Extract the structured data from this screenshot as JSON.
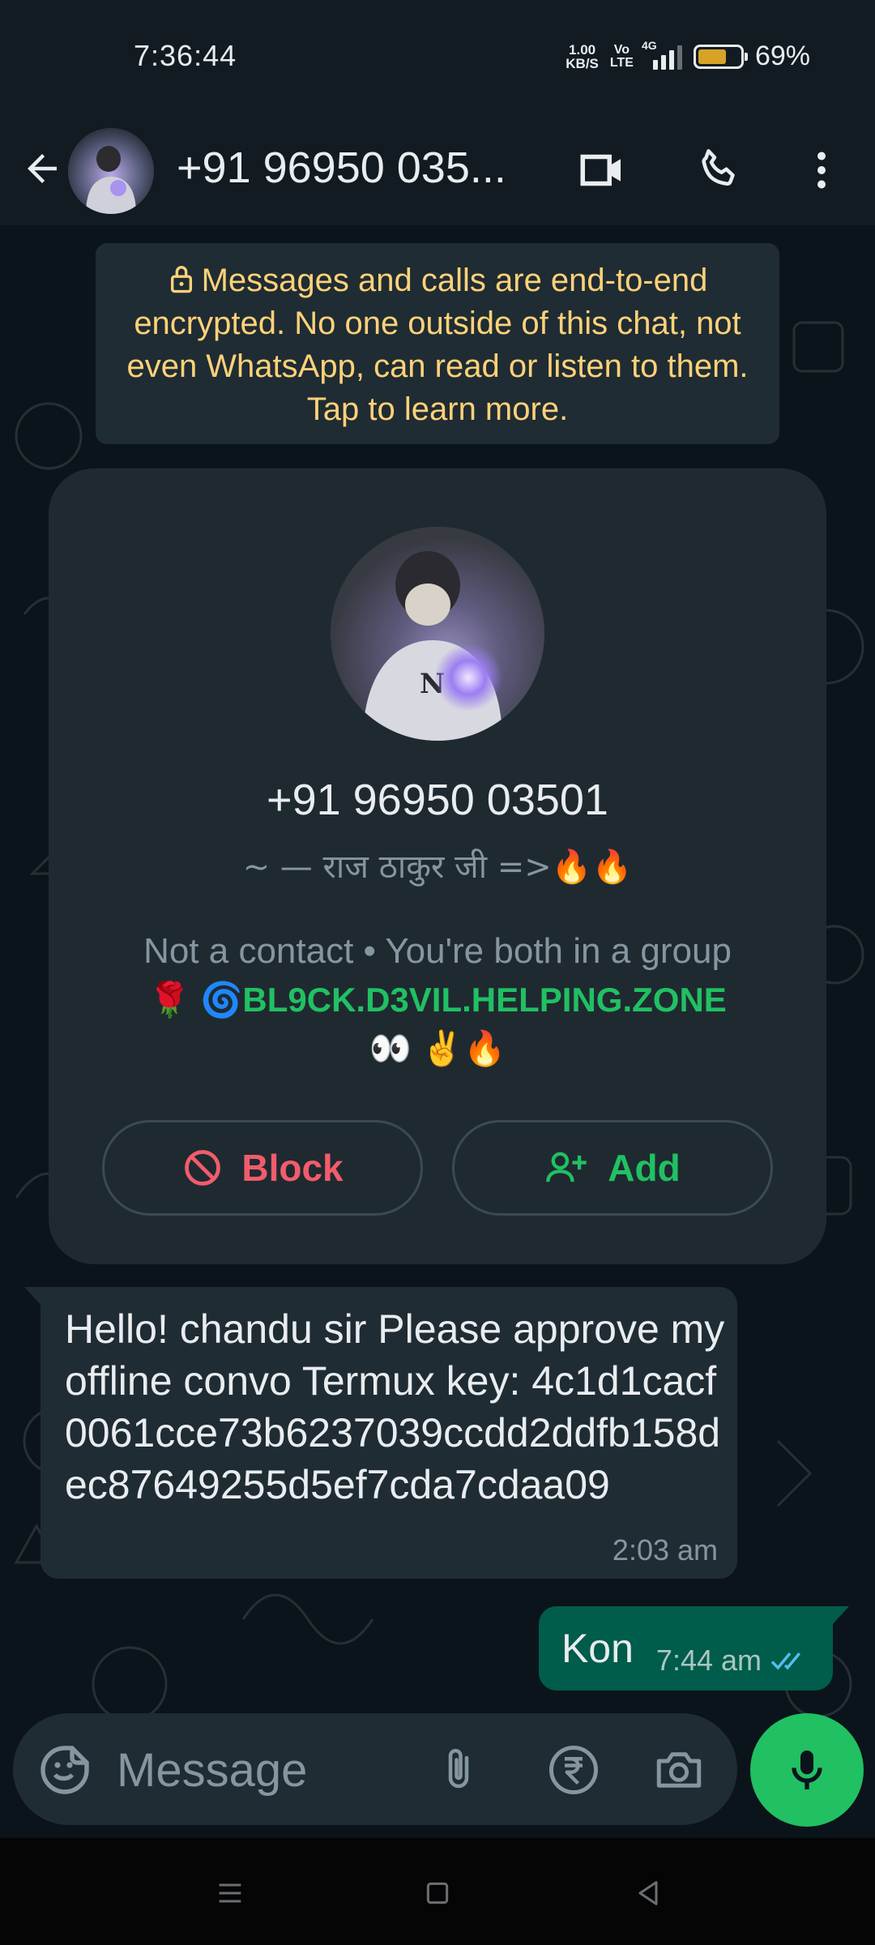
{
  "status_bar": {
    "time": "7:36:44",
    "speed_value": "1.00",
    "speed_unit": "KB/S",
    "volte_top": "Vo",
    "volte_bottom": "LTE",
    "network": "4G",
    "battery_percent": "69%",
    "battery_level": 0.69
  },
  "header": {
    "title": "+91 96950 035...",
    "back_icon": "arrow-left-icon",
    "video_icon": "video-camera-icon",
    "call_icon": "phone-icon",
    "menu_icon": "more-vert-icon"
  },
  "encryption_notice": {
    "text": "Messages and calls are end-to-end encrypted. No one outside of this chat, not even WhatsApp, can read or listen to them. Tap to learn more."
  },
  "contact_card": {
    "number": "+91 96950 03501",
    "about": "~ — राज ठाकुर जी =>🔥🔥",
    "info": "Not a contact • You're both in a group",
    "group_prefix": "🌹 🌀",
    "group_name": "BL9CK.D3VIL.HELPING.ZONE",
    "group_suffix": "👀 ✌️🔥",
    "block_label": "Block",
    "add_label": "Add"
  },
  "messages": [
    {
      "direction": "incoming",
      "text": "Hello! chandu sir Please approve my offline convo Termux key: 4c1d1cacf0061cce73b6237039ccdd2ddfb158dec87649255d5ef7cda7cdaa09",
      "time": "2:03 am"
    },
    {
      "direction": "outgoing",
      "text": "Kon",
      "time": "7:44 am",
      "status": "read"
    }
  ],
  "composer": {
    "placeholder": "Message"
  },
  "colors": {
    "accent": "#21c063",
    "header_bg": "#111b21",
    "incoming_bubble": "#202c33",
    "outgoing_bubble": "#005c4b",
    "block_red": "#f15c6d",
    "encryption_yellow": "#ffd279",
    "read_ticks": "#53bdeb"
  }
}
